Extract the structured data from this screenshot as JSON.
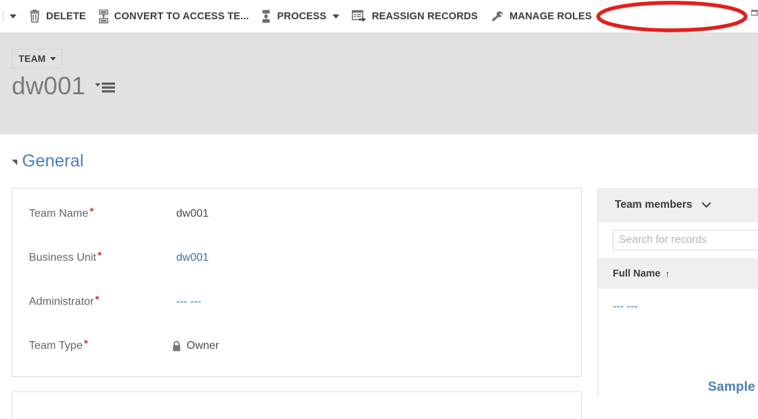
{
  "command_bar": {
    "overflow_caret_left": "caret-down-icon",
    "buttons": [
      {
        "icon": "trash-delete-icon",
        "label": "DELETE",
        "has_caret": false
      },
      {
        "icon": "convert-access-team-icon",
        "label": "CONVERT TO ACCESS TE...",
        "has_caret": false
      },
      {
        "icon": "process-icon",
        "label": "PROCESS",
        "has_caret": true
      },
      {
        "icon": "reassign-records-icon",
        "label": "REASSIGN RECORDS",
        "has_caret": false
      },
      {
        "icon": "manage-roles-icon",
        "label": "MANAGE ROLES",
        "has_caret": false
      }
    ]
  },
  "record_header": {
    "entity_type_label": "TEAM",
    "record_title": "dw001",
    "form_selector_icon": "form-selector-icon"
  },
  "form": {
    "section_title": "General",
    "fields": [
      {
        "label": "Team Name",
        "required": true,
        "value": "dw001",
        "is_link": false,
        "has_lock": false
      },
      {
        "label": "Business Unit",
        "required": true,
        "value": "dw001",
        "is_link": true,
        "has_lock": false
      },
      {
        "label": "Administrator",
        "required": true,
        "value": "--- ---",
        "is_link": true,
        "has_lock": false
      },
      {
        "label": "Team Type",
        "required": true,
        "value": "Owner",
        "is_link": false,
        "has_lock": true
      }
    ]
  },
  "team_members": {
    "title": "Team members",
    "expand_icon": "chevron-down-icon",
    "search_placeholder": "Search for records",
    "search_value": "",
    "column_header": "Full Name",
    "sort_indicator": "↑",
    "rows": [
      {
        "full_name": "--- ---"
      }
    ],
    "watermark": "Sample"
  },
  "annotation": {
    "shape": "ellipse",
    "color": "#e02020",
    "target": "MANAGE ROLES"
  },
  "colors": {
    "header_band": "#e1e1e1",
    "link_blue": "#3b6fb6",
    "section_blue": "#4a7ebb",
    "required_red": "#c83232",
    "annotation_red": "#e02020"
  }
}
